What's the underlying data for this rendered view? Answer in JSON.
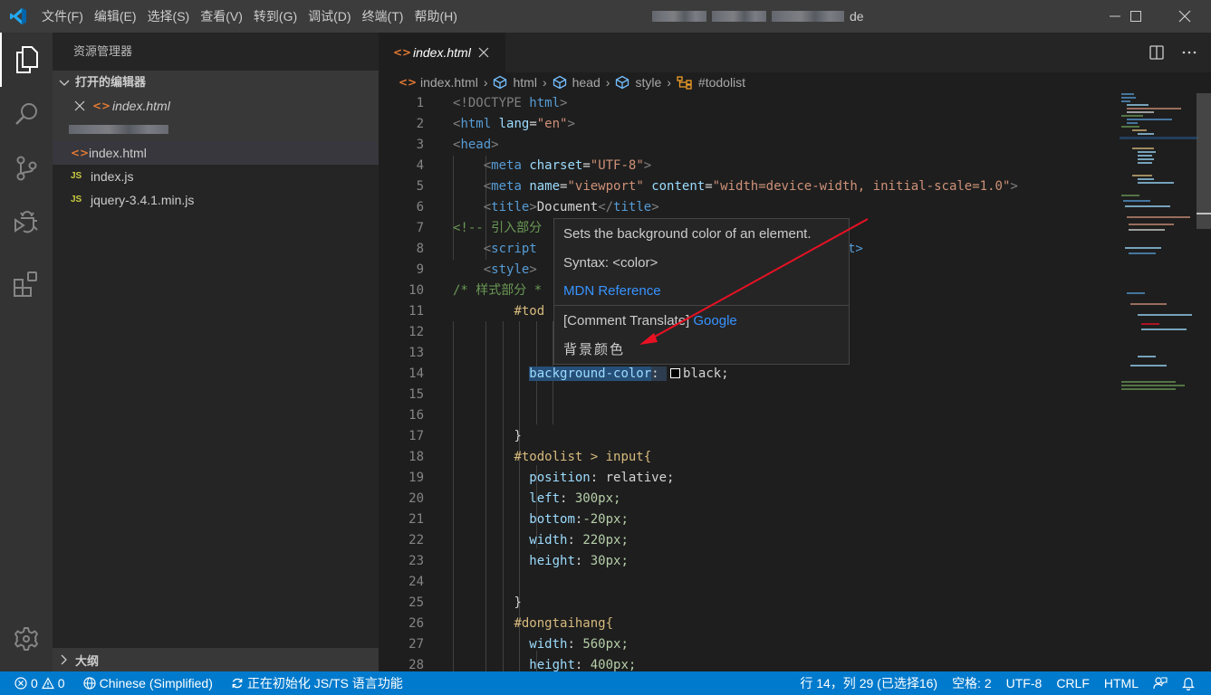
{
  "titlebar": {
    "menu": [
      "文件(F)",
      "编辑(E)",
      "选择(S)",
      "查看(V)",
      "转到(G)",
      "调试(D)",
      "终端(T)",
      "帮助(H)"
    ],
    "window_title_suffix": "de"
  },
  "activitybar": {
    "items": [
      "explorer",
      "search",
      "source-control",
      "debug",
      "extensions"
    ],
    "bottom": "manage"
  },
  "sidebar": {
    "title": "资源管理器",
    "open_editors_label": "打开的编辑器",
    "open_editors": [
      {
        "name": "index.html",
        "type": "html"
      }
    ],
    "files": [
      {
        "name": "index.html",
        "type": "html",
        "icon": "<>"
      },
      {
        "name": "index.js",
        "type": "js",
        "icon": "JS"
      },
      {
        "name": "jquery-3.4.1.min.js",
        "type": "js",
        "icon": "JS"
      }
    ],
    "outline_label": "大纲"
  },
  "editor": {
    "tab": {
      "label": "index.html"
    },
    "breadcrumb": [
      "index.html",
      "html",
      "head",
      "style",
      "#todolist"
    ],
    "lines": [
      {
        "n": "1"
      },
      {
        "n": "2"
      },
      {
        "n": "3"
      },
      {
        "n": "4"
      },
      {
        "n": "5"
      },
      {
        "n": "6"
      },
      {
        "n": "7"
      },
      {
        "n": "8"
      },
      {
        "n": "9"
      },
      {
        "n": "10"
      },
      {
        "n": "11"
      },
      {
        "n": "12"
      },
      {
        "n": "13"
      },
      {
        "n": "14"
      },
      {
        "n": "15"
      },
      {
        "n": "16"
      },
      {
        "n": "17"
      },
      {
        "n": "18"
      },
      {
        "n": "19"
      },
      {
        "n": "20"
      },
      {
        "n": "21"
      },
      {
        "n": "22"
      },
      {
        "n": "23"
      },
      {
        "n": "24"
      },
      {
        "n": "25"
      },
      {
        "n": "26"
      },
      {
        "n": "27"
      },
      {
        "n": "28"
      }
    ],
    "code": {
      "l1_doctype": "<!DOCTYPE",
      "l1_html": "html",
      "l2_tag": "html",
      "l2_attr": "lang",
      "l2_val": "\"en\"",
      "l3_tag": "head",
      "l4_tag": "meta",
      "l4_attr": "charset",
      "l4_val": "\"UTF-8\"",
      "l5_tag": "meta",
      "l5_attr1": "name",
      "l5_val1": "\"viewport\"",
      "l5_attr2": "content",
      "l5_val2": "\"width=device-width, initial-scale=1.0\"",
      "l6_tag": "title",
      "l6_text": "Document",
      "l7_comment": "<!-- 引入部分",
      "l8_tag": "script",
      "l8_tail": "t>",
      "l9_tag": "style",
      "l10_comment": "/* 样式部分 *",
      "l11_sel": "#tod",
      "l14_prop": "background-color",
      "l14_val": "black;",
      "l17_text": "}",
      "l18_sel": "#todolist > input{",
      "l19_prop": "position",
      "l19_val": "relative;",
      "l20_prop": "left",
      "l20_val": "300px;",
      "l21_prop": "bottom",
      "l21_val": "-20px;",
      "l22_prop": "width",
      "l22_val": "220px;",
      "l23_prop": "height",
      "l23_val": "30px;",
      "l25_text": "}",
      "l26_sel": "#dongtaihang{",
      "l27_prop": "width",
      "l27_val": "560px;",
      "l28_prop": "height",
      "l28_val": "400px;"
    },
    "hover": {
      "description": "Sets the background color of an element.",
      "syntax": "Syntax: <color>",
      "mdn_link": "MDN Reference",
      "translate_prefix": "[Comment Translate]",
      "translate_link": "Google",
      "translation": "背景颜色"
    }
  },
  "statusbar": {
    "errors": "0",
    "warnings": "0",
    "language_pack": "Chinese (Simplified)",
    "initializing": "正在初始化 JS/TS 语言功能",
    "cursor": "行 14，列 29 (已选择16)",
    "spaces": "空格: 2",
    "encoding": "UTF-8",
    "eol": "CRLF",
    "language": "HTML"
  },
  "colors": {
    "accent": "#007acc",
    "annotation_arrow": "#e81123"
  }
}
